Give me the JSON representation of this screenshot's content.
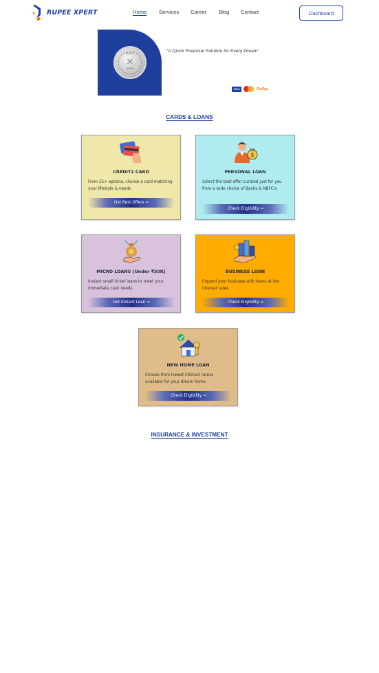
{
  "brand": {
    "name": "RUPEE XPERT"
  },
  "nav": {
    "items": [
      "Home",
      "Services",
      "Career",
      "Blog",
      "Contact"
    ],
    "active": "Home",
    "dashboard_label": "Dashboard"
  },
  "hero": {
    "badge_top": "RUPEE",
    "badge_mid": "XPERT",
    "badge_sub": "2019",
    "tagline": "“A Quick Financial Solution for Every Dream”",
    "payments": {
      "visa": "VISA",
      "rupay": "RuPay"
    }
  },
  "sections": {
    "cards_loans": "CARDS & LOANS",
    "insurance": "INSURANCE & INVESTMENT"
  },
  "cards": [
    {
      "title": "CREDIT2 CARD",
      "desc": "From 35+ options, choose a card matching your lifestyle & needs",
      "button": "Get Best Offers ⇒",
      "bg": "#f0e8aa",
      "icon": "credit-card-icon"
    },
    {
      "title": "PERSONAL LOAN",
      "desc": "Select the best offer curated just for you from a wide choice of Banks & NBFC's",
      "button": "Check Eligibility ⇒",
      "bg": "#aeecf0",
      "icon": "person-money-bag-icon"
    },
    {
      "title": "MICRO LOANS (Under ₹50K)",
      "desc": "Instant small ticket loans to meet your immediate cash needs",
      "button": "Get Instant Loan ⇒",
      "bg": "#d9c2dc",
      "icon": "hand-money-bag-icon"
    },
    {
      "title": "BUSINESS LOAN",
      "desc": "Expand your business with loans at low interest rates",
      "button": "Check Eligibility ⇒",
      "bg": "#ffab00",
      "icon": "hand-buildings-icon"
    },
    {
      "title": "NEW HOME LOAN",
      "desc": "Choose from lowest interest ratess available for your dream home",
      "button": "Check Eligibility ⇒",
      "bg": "#e0bc8a",
      "icon": "house-coin-icon"
    }
  ]
}
